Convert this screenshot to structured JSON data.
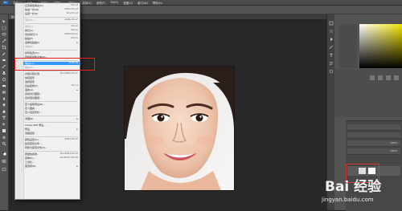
{
  "menubar": {
    "logo": "Ps",
    "items": [
      "文件(F)",
      "编辑(E)",
      "图像(I)",
      "图层(L)",
      "类型(Y)",
      "选择(S)",
      "滤镜(T)",
      "3D(D)",
      "视图(V)",
      "窗口(W)",
      "帮助(H)"
    ],
    "active_index": 1
  },
  "document": {
    "tab_label": "图片.jpg @ 66.7% (RGB/8)"
  },
  "edit_menu": {
    "items": [
      {
        "label": "还原颜色填充(O)",
        "shortcut": "Ctrl+Z"
      },
      {
        "label": "前进一步(W)",
        "shortcut": "Shift+Ctrl+Z"
      },
      {
        "label": "后退一步(K)",
        "shortcut": "Alt+Ctrl+Z"
      },
      {
        "sep": true
      },
      {
        "label": "渐隐(D)...",
        "shortcut": "Shift+Ctrl+F",
        "disabled": true
      },
      {
        "sep": true
      },
      {
        "label": "剪切(T)",
        "shortcut": "Ctrl+X",
        "disabled": true
      },
      {
        "label": "拷贝(C)",
        "shortcut": "Ctrl+C"
      },
      {
        "label": "合并拷贝(Y)",
        "shortcut": "Shift+Ctrl+C"
      },
      {
        "label": "粘贴(P)",
        "shortcut": "Ctrl+V"
      },
      {
        "label": "选择性粘贴(I)",
        "arrow": true
      },
      {
        "label": "清除(E)",
        "disabled": true
      },
      {
        "sep": true
      },
      {
        "label": "拼写检查(H)..."
      },
      {
        "label": "查找和替换文本(X)..."
      },
      {
        "sep": true
      },
      {
        "label": "填充(L)...",
        "shortcut": "Shift+F5"
      },
      {
        "label": "描边(S)...",
        "disabled": true
      },
      {
        "sep": true
      },
      {
        "label": "内容识别比例",
        "shortcut": "Alt+Shift+Ctrl+C"
      },
      {
        "label": "操控变形"
      },
      {
        "label": "透视变形"
      },
      {
        "label": "自由变换(F)",
        "shortcut": "Ctrl+T"
      },
      {
        "label": "变换(A)",
        "arrow": true
      },
      {
        "label": "自动对齐图层..."
      },
      {
        "label": "自动混合图层..."
      },
      {
        "sep": true
      },
      {
        "label": "定义画笔预设(B)..."
      },
      {
        "label": "定义图案..."
      },
      {
        "label": "定义自定形状..."
      },
      {
        "sep": true
      },
      {
        "label": "清理(R)",
        "arrow": true
      },
      {
        "sep": true
      },
      {
        "label": "Adobe PDF 预设..."
      },
      {
        "label": "预设",
        "arrow": true
      },
      {
        "label": "远程连接..."
      },
      {
        "sep": true
      },
      {
        "label": "颜色设置(G)...",
        "shortcut": "Shift+Ctrl+K"
      },
      {
        "label": "指定配置文件..."
      },
      {
        "label": "转换为配置文件(V)..."
      },
      {
        "sep": true
      },
      {
        "label": "键盘快捷键...",
        "shortcut": "Alt+Shift+Ctrl+K"
      },
      {
        "label": "菜单(U)...",
        "shortcut": "Alt+Shift+Ctrl+M"
      },
      {
        "label": "工具栏..."
      },
      {
        "label": "首选项(N)",
        "arrow": true
      }
    ],
    "highlighted_label": "填充(L)..."
  },
  "layers": {
    "opacity": "100%",
    "fill": "100%"
  },
  "watermark": {
    "brand": "Bai 经验",
    "url": "jingyan.baidu.com"
  },
  "colors": {
    "highlight": "#3399ff",
    "callout": "#e02020",
    "ps_blue": "#2b5f9e"
  }
}
